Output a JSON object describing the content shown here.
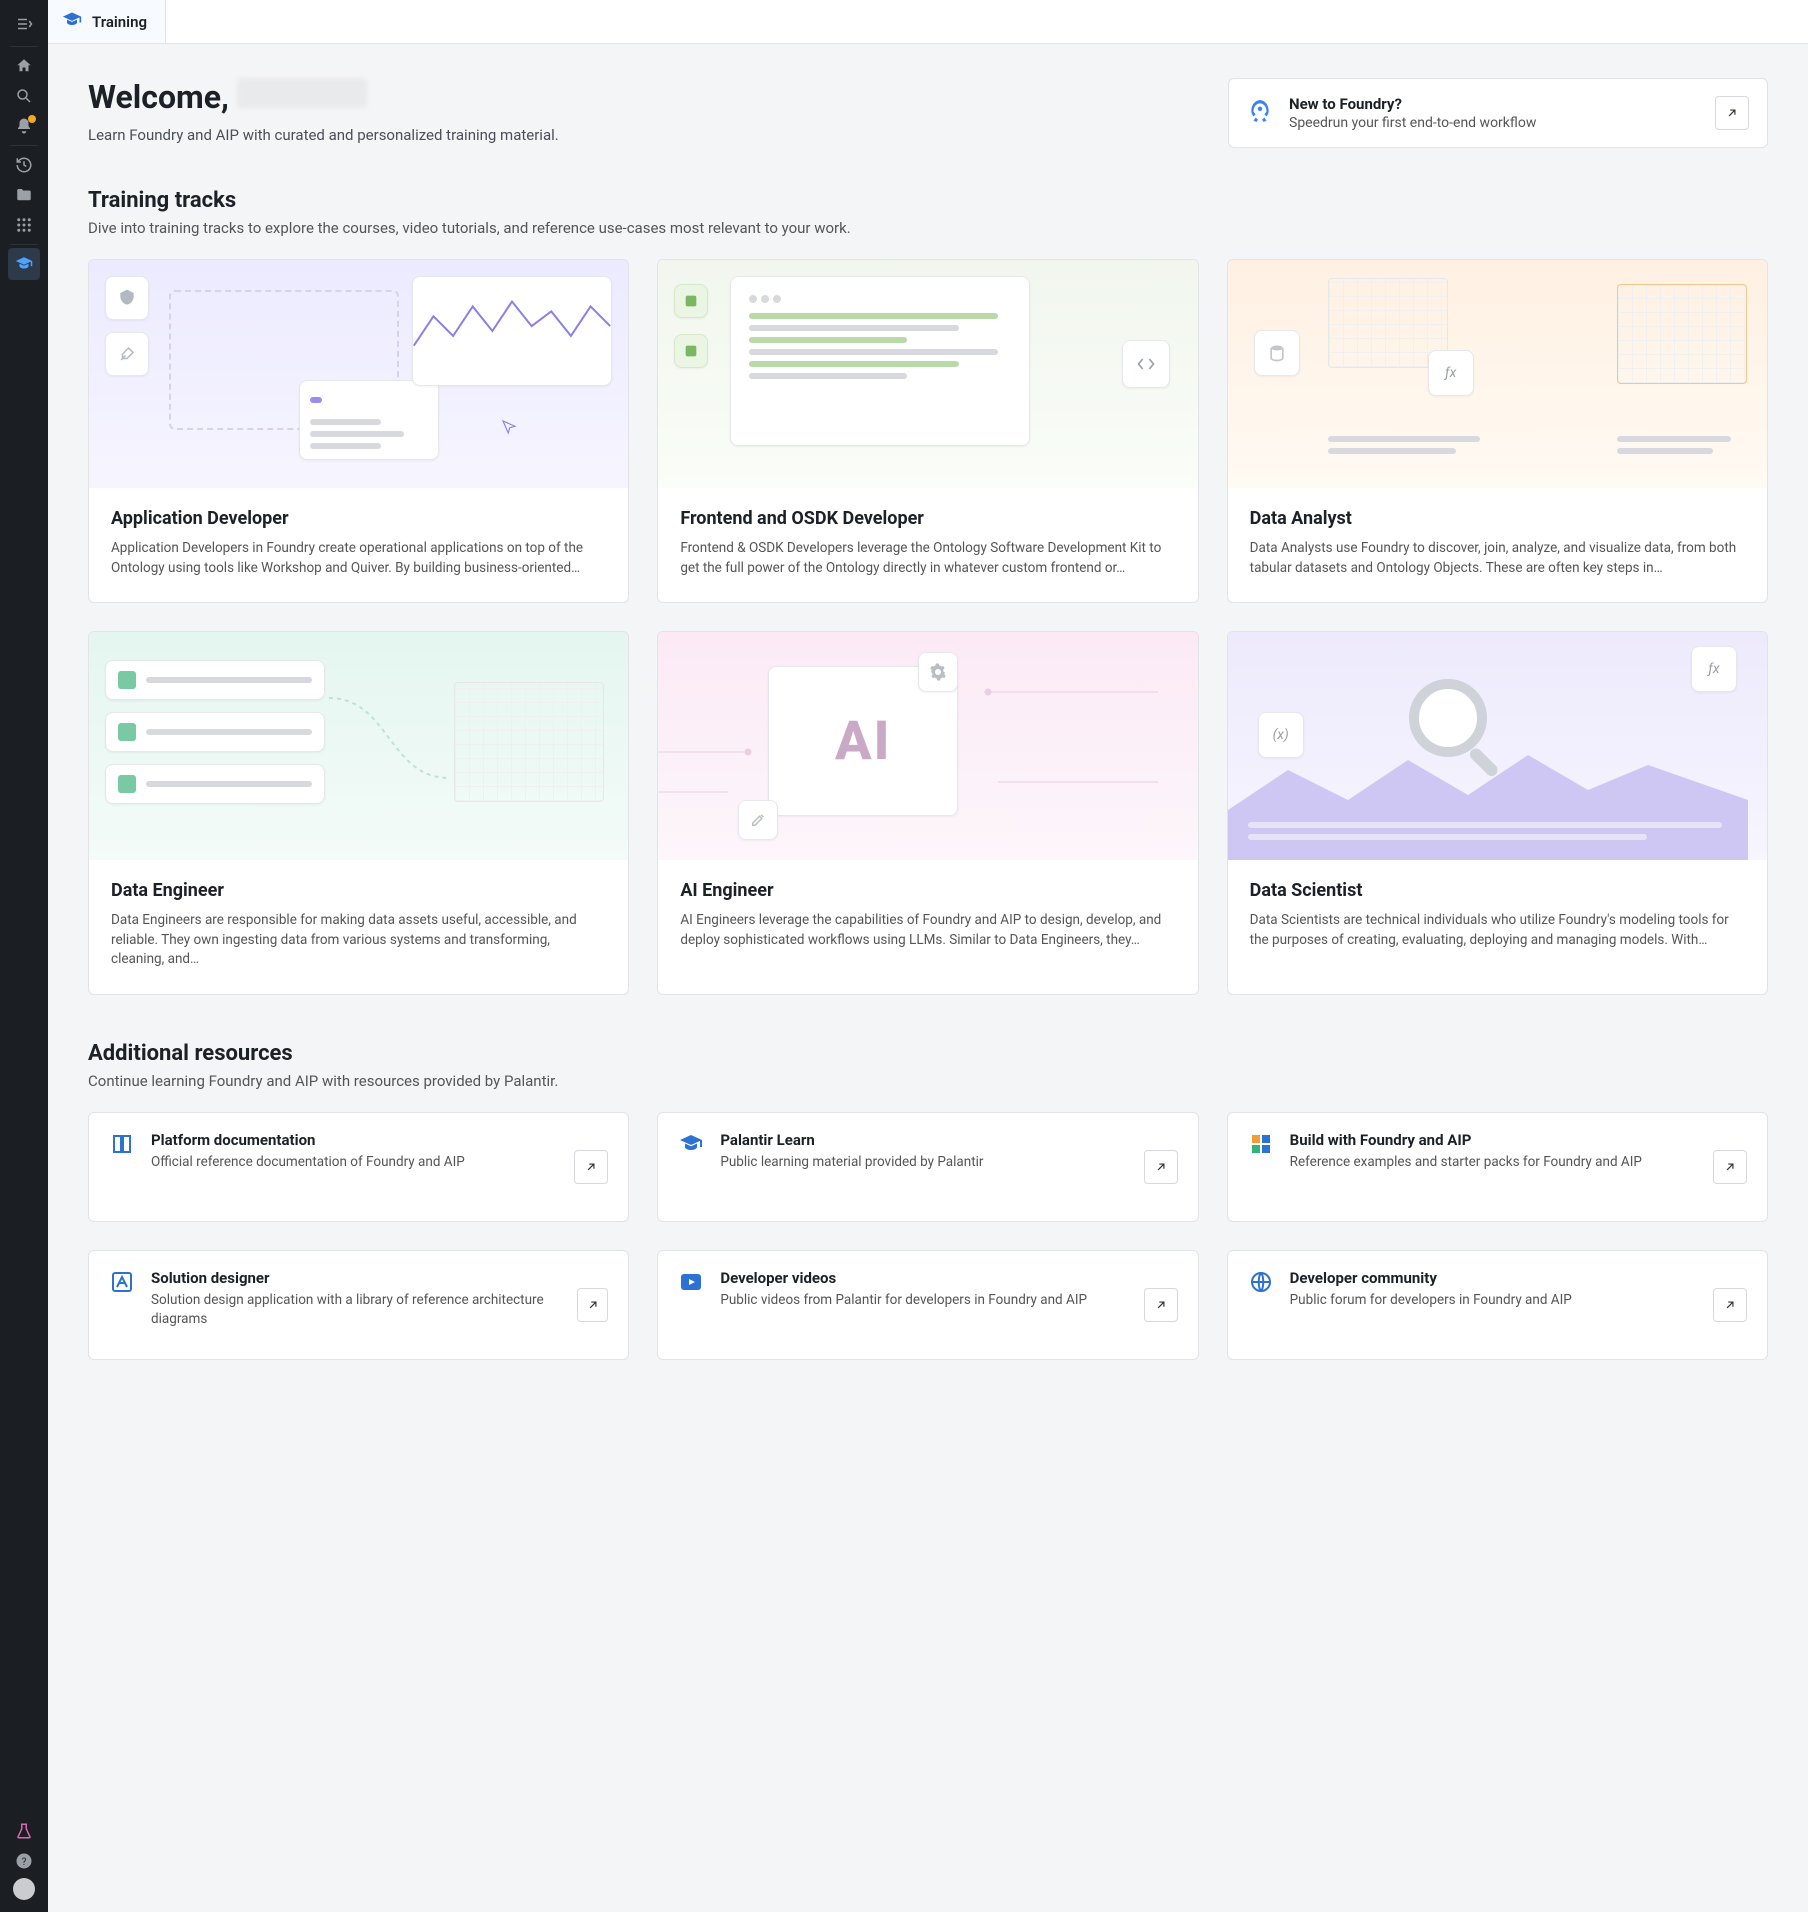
{
  "topbar": {
    "app_label": "Training"
  },
  "welcome": {
    "greeting": "Welcome, ",
    "subtitle": "Learn Foundry and AIP with curated and personalized training material."
  },
  "cta": {
    "title": "New to Foundry?",
    "subtitle": "Speedrun your first end-to-end workflow"
  },
  "tracks_section": {
    "title": "Training tracks",
    "subtitle": "Dive into training tracks to explore the courses, video tutorials, and reference use-cases most relevant to your work."
  },
  "tracks": [
    {
      "title": "Application Developer",
      "desc": "Application Developers in Foundry create operational applications on top of the Ontology using tools like Workshop and Quiver. By building business-oriented…",
      "theme": "illus-purple"
    },
    {
      "title": "Frontend and OSDK Developer",
      "desc": "Frontend & OSDK Developers leverage the Ontology Software Development Kit to get the full power of the Ontology directly in whatever custom frontend or…",
      "theme": "illus-green"
    },
    {
      "title": "Data Analyst",
      "desc": "Data Analysts use Foundry to discover, join, analyze, and visualize data, from both tabular datasets and Ontology Objects. These are often key steps in…",
      "theme": "illus-orange"
    },
    {
      "title": "Data Engineer",
      "desc": "Data Engineers are responsible for making data assets useful, accessible, and reliable. They own ingesting data from various systems and transforming, cleaning, and…",
      "theme": "illus-teal"
    },
    {
      "title": "AI Engineer",
      "desc": "AI Engineers leverage the capabilities of Foundry and AIP to design, develop, and deploy sophisticated workflows using LLMs. Similar to Data Engineers, they…",
      "theme": "illus-pink"
    },
    {
      "title": "Data Scientist",
      "desc": "Data Scientists are technical individuals who utilize Foundry's modeling tools for the purposes of creating, evaluating, deploying and managing models. With…",
      "theme": "illus-lav"
    }
  ],
  "resources_section": {
    "title": "Additional resources",
    "subtitle": "Continue learning Foundry and AIP with resources provided by Palantir."
  },
  "resources": [
    {
      "title": "Platform documentation",
      "desc": "Official reference documentation of Foundry and AIP",
      "icon": "book"
    },
    {
      "title": "Palantir Learn",
      "desc": "Public learning material provided by Palantir",
      "icon": "cap"
    },
    {
      "title": "Build with Foundry and AIP",
      "desc": "Reference examples and starter packs for Foundry and AIP",
      "icon": "blocks"
    },
    {
      "title": "Solution designer",
      "desc": "Solution design application with a library of reference architecture diagrams",
      "icon": "designer"
    },
    {
      "title": "Developer videos",
      "desc": "Public videos from Palantir for developers in Foundry and AIP",
      "icon": "play"
    },
    {
      "title": "Developer community",
      "desc": "Public forum for developers in Foundry and AIP",
      "icon": "globe"
    }
  ]
}
